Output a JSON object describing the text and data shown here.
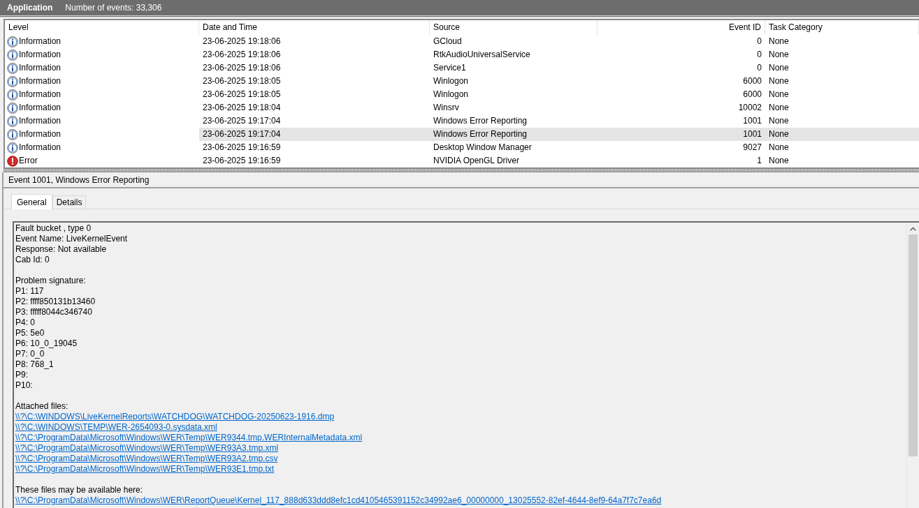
{
  "header": {
    "title": "Application",
    "event_count": "Number of events: 33,306"
  },
  "table": {
    "columns": [
      "Level",
      "Date and Time",
      "Source",
      "Event ID",
      "Task Category"
    ],
    "rows": [
      {
        "kind": "information",
        "level": "Information",
        "date_time": "23-06-2025 19:18:06",
        "source": "GCloud",
        "event_id": "0",
        "task_category": "None",
        "selected": false
      },
      {
        "kind": "information",
        "level": "Information",
        "date_time": "23-06-2025 19:18:06",
        "source": "RtkAudioUniversalService",
        "event_id": "0",
        "task_category": "None",
        "selected": false
      },
      {
        "kind": "information",
        "level": "Information",
        "date_time": "23-06-2025 19:18:06",
        "source": "Service1",
        "event_id": "0",
        "task_category": "None",
        "selected": false
      },
      {
        "kind": "information",
        "level": "Information",
        "date_time": "23-06-2025 19:18:05",
        "source": "Winlogon",
        "event_id": "6000",
        "task_category": "None",
        "selected": false
      },
      {
        "kind": "information",
        "level": "Information",
        "date_time": "23-06-2025 19:18:05",
        "source": "Winlogon",
        "event_id": "6000",
        "task_category": "None",
        "selected": false
      },
      {
        "kind": "information",
        "level": "Information",
        "date_time": "23-06-2025 19:18:04",
        "source": "Winsrv",
        "event_id": "10002",
        "task_category": "None",
        "selected": false
      },
      {
        "kind": "information",
        "level": "Information",
        "date_time": "23-06-2025 19:17:04",
        "source": "Windows Error Reporting",
        "event_id": "1001",
        "task_category": "None",
        "selected": false
      },
      {
        "kind": "information",
        "level": "Information",
        "date_time": "23-06-2025 19:17:04",
        "source": "Windows Error Reporting",
        "event_id": "1001",
        "task_category": "None",
        "selected": true
      },
      {
        "kind": "information",
        "level": "Information",
        "date_time": "23-06-2025 19:16:59",
        "source": "Desktop Window Manager",
        "event_id": "9027",
        "task_category": "None",
        "selected": false
      },
      {
        "kind": "error",
        "level": "Error",
        "date_time": "23-06-2025 19:16:59",
        "source": "NVIDIA OpenGL Driver",
        "event_id": "1",
        "task_category": "None",
        "selected": false
      }
    ]
  },
  "detail": {
    "title": "Event 1001, Windows Error Reporting",
    "tabs": [
      {
        "label": "General",
        "selected": true
      },
      {
        "label": "Details",
        "selected": false
      }
    ],
    "sections": [
      {
        "lines": [
          {
            "kind": "text",
            "text": "Fault bucket , type 0"
          },
          {
            "kind": "text",
            "text": "Event Name: LiveKernelEvent"
          },
          {
            "kind": "text",
            "text": "Response: Not available"
          },
          {
            "kind": "text",
            "text": "Cab Id: 0"
          }
        ]
      },
      {
        "lines": [
          {
            "kind": "text",
            "text": "Problem signature:"
          },
          {
            "kind": "text",
            "text": "P1: 117"
          },
          {
            "kind": "text",
            "text": "P2: ffff850131b13460"
          },
          {
            "kind": "text",
            "text": "P3: fffff8044c346740"
          },
          {
            "kind": "text",
            "text": "P4: 0"
          },
          {
            "kind": "text",
            "text": "P5: 5e0"
          },
          {
            "kind": "text",
            "text": "P6: 10_0_19045"
          },
          {
            "kind": "text",
            "text": "P7: 0_0"
          },
          {
            "kind": "text",
            "text": "P8: 768_1"
          },
          {
            "kind": "text",
            "text": "P9:"
          },
          {
            "kind": "text",
            "text": "P10:"
          }
        ]
      },
      {
        "lines": [
          {
            "kind": "text",
            "text": "Attached files:"
          },
          {
            "kind": "link",
            "text": "\\\\?\\C:\\WINDOWS\\LiveKernelReports\\WATCHDOG\\WATCHDOG-20250623-1916.dmp"
          },
          {
            "kind": "link",
            "text": "\\\\?\\C:\\WINDOWS\\TEMP\\WER-2654093-0.sysdata.xml"
          },
          {
            "kind": "link",
            "text": "\\\\?\\C:\\ProgramData\\Microsoft\\Windows\\WER\\Temp\\WER9344.tmp.WERInternalMetadata.xml"
          },
          {
            "kind": "link",
            "text": "\\\\?\\C:\\ProgramData\\Microsoft\\Windows\\WER\\Temp\\WER93A3.tmp.xml"
          },
          {
            "kind": "link",
            "text": "\\\\?\\C:\\ProgramData\\Microsoft\\Windows\\WER\\Temp\\WER93A2.tmp.csv"
          },
          {
            "kind": "link",
            "text": "\\\\?\\C:\\ProgramData\\Microsoft\\Windows\\WER\\Temp\\WER93E1.tmp.txt"
          }
        ]
      },
      {
        "lines": [
          {
            "kind": "text",
            "text": "These files may be available here:"
          },
          {
            "kind": "link",
            "text": "\\\\?\\C:\\ProgramData\\Microsoft\\Windows\\WER\\ReportQueue\\Kernel_117_888d633ddd8efc1cd4105465391152c34992ae6_00000000_13025552-82ef-4644-8ef9-64a7f7c7ea6d"
          }
        ]
      }
    ]
  }
}
